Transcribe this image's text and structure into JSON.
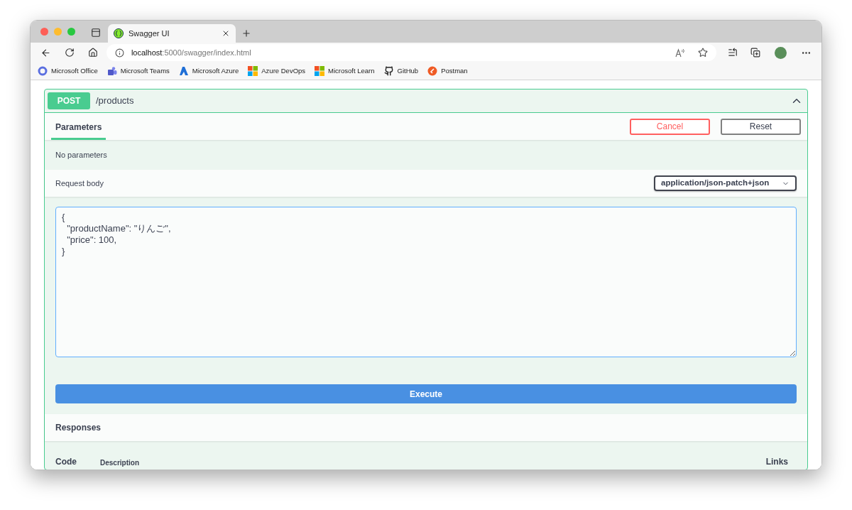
{
  "browser": {
    "tab": {
      "title": "Swagger UI",
      "selected": true
    },
    "address": {
      "host": "localhost",
      "path": ":5000/swagger/index.html"
    },
    "bookmarks": [
      {
        "label": "Microsoft Office",
        "kind": "ring"
      },
      {
        "label": "Microsoft Teams",
        "kind": "people"
      },
      {
        "label": "Microsoft Azure",
        "kind": "triangle"
      },
      {
        "label": "Azure DevOps",
        "kind": "grid"
      },
      {
        "label": "Microsoft Learn",
        "kind": "grid"
      },
      {
        "label": "GitHub",
        "kind": "cat"
      },
      {
        "label": "Postman",
        "kind": "round"
      }
    ]
  },
  "operation": {
    "method": "POST",
    "path": "/products",
    "expanded": true,
    "tabs": [
      {
        "label": "Parameters",
        "selected": true
      }
    ],
    "buttons": [
      {
        "label": "Cancel",
        "kind": "cancel"
      },
      {
        "label": "Reset",
        "kind": "reset"
      }
    ],
    "parameters_note": "No parameters",
    "request_body": {
      "label": "Request body",
      "content_type": "application/json-patch+json",
      "value": "{\n  \"productName\": \"りんご\",\n  \"price\": 100,\n}"
    },
    "execute": "Execute",
    "responses": {
      "title": "Responses",
      "columns": [
        "Code",
        "Description",
        "Links"
      ]
    }
  }
}
